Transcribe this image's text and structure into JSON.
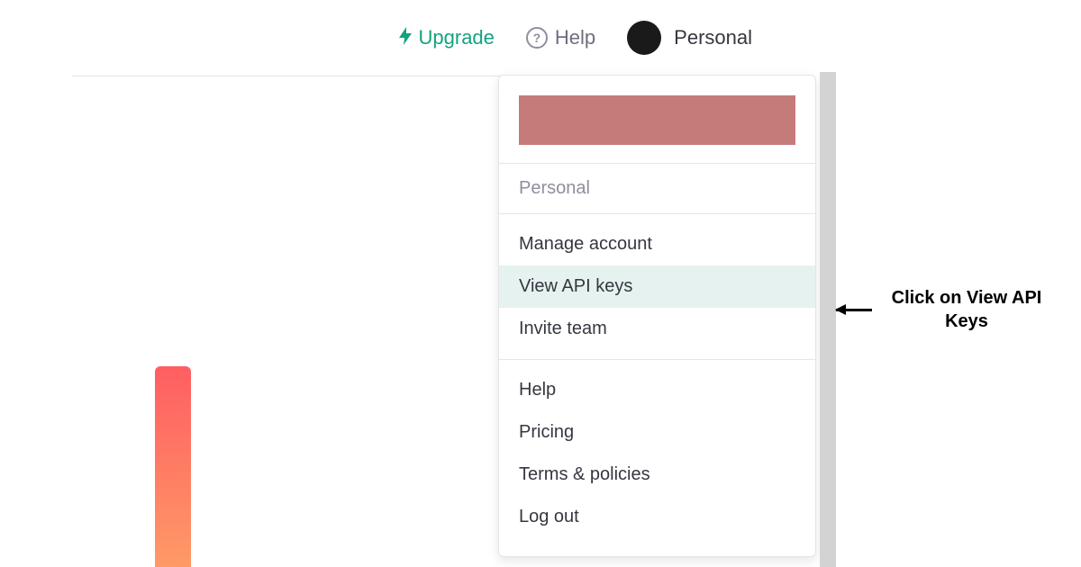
{
  "header": {
    "upgrade_label": "Upgrade",
    "help_label": "Help",
    "user_label": "Personal"
  },
  "dropdown": {
    "section_label": "Personal",
    "items_account": [
      {
        "label": "Manage account",
        "highlighted": false
      },
      {
        "label": "View API keys",
        "highlighted": true
      },
      {
        "label": "Invite team",
        "highlighted": false
      }
    ],
    "items_other": [
      {
        "label": "Help"
      },
      {
        "label": "Pricing"
      },
      {
        "label": "Terms & policies"
      },
      {
        "label": "Log out"
      }
    ]
  },
  "annotation": {
    "text_line1": "Click on View API",
    "text_line2": "Keys"
  },
  "colors": {
    "accent": "#11a37f",
    "redacted": "#c67b7b",
    "highlight": "#e6f2ef"
  }
}
